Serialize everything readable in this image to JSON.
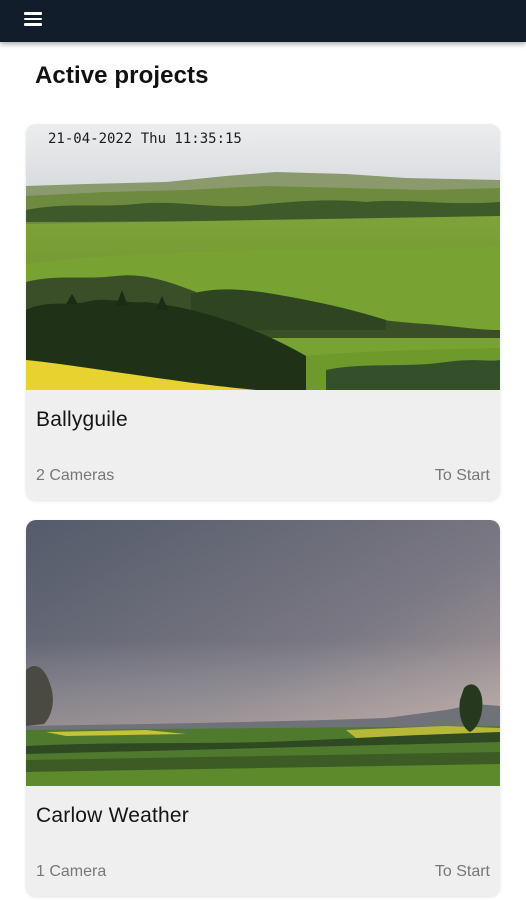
{
  "appbar": {
    "menu_icon": "hamburger-menu-icon",
    "background": "#111d2b"
  },
  "page": {
    "title": "Active projects"
  },
  "projects": [
    {
      "timestamp": "21-04-2022 Thu 11:35:15",
      "name": "Ballyguile",
      "cameras": "2 Cameras",
      "action": "To Start"
    },
    {
      "name": "Carlow Weather",
      "cameras": "1 Camera",
      "action": "To Start"
    }
  ]
}
